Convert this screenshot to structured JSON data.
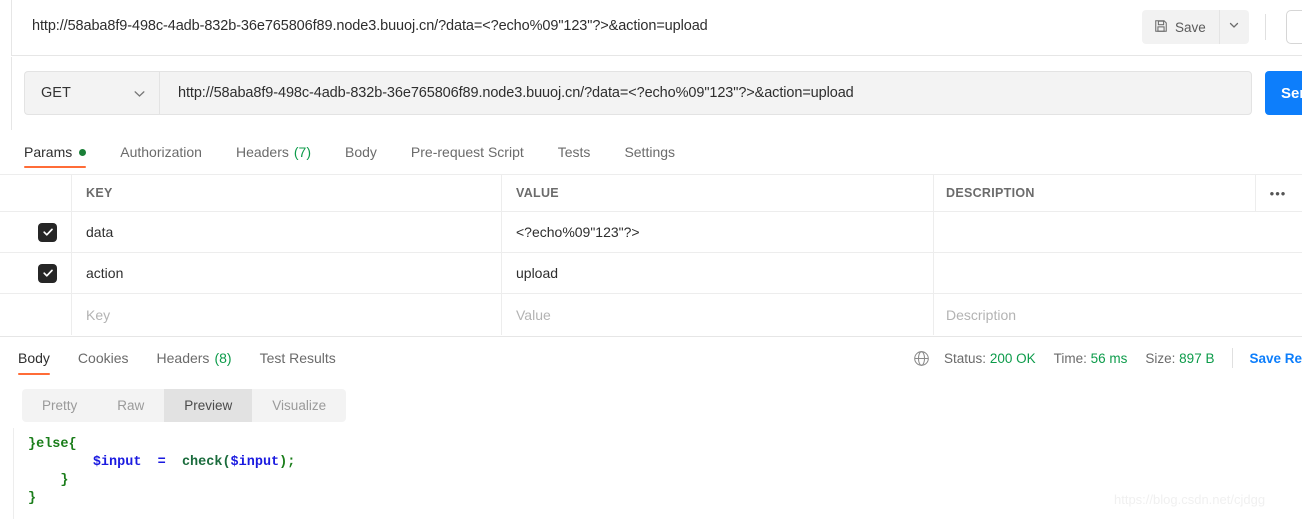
{
  "titlebar": {
    "request_title": "http://58aba8f9-498c-4adb-832b-36e765806f89.node3.buuoj.cn/?data=<?echo%09\"123\"?>&action=upload",
    "save_label": "Save"
  },
  "urlbar": {
    "method": "GET",
    "url": "http://58aba8f9-498c-4adb-832b-36e765806f89.node3.buuoj.cn/?data=<?echo%09\"123\"?>&action=upload",
    "send_label": "Send"
  },
  "request_tabs": [
    {
      "label": "Params",
      "active": true,
      "dot": true
    },
    {
      "label": "Authorization",
      "active": false
    },
    {
      "label": "Headers",
      "count": "(7)",
      "active": false
    },
    {
      "label": "Body",
      "active": false
    },
    {
      "label": "Pre-request Script",
      "active": false
    },
    {
      "label": "Tests",
      "active": false
    },
    {
      "label": "Settings",
      "active": false
    }
  ],
  "params_table": {
    "headers": {
      "key": "KEY",
      "value": "VALUE",
      "description": "DESCRIPTION",
      "more": "•••"
    },
    "rows": [
      {
        "checked": true,
        "key": "data",
        "value": "<?echo%09\"123\"?>",
        "description": ""
      },
      {
        "checked": true,
        "key": "action",
        "value": "upload",
        "description": ""
      }
    ],
    "placeholder_row": {
      "key": "Key",
      "value": "Value",
      "description": "Description"
    }
  },
  "response_tabs": [
    {
      "label": "Body",
      "active": true
    },
    {
      "label": "Cookies",
      "active": false
    },
    {
      "label": "Headers",
      "count": "(8)",
      "active": false
    },
    {
      "label": "Test Results",
      "active": false
    }
  ],
  "response_status": {
    "status_label": "Status:",
    "status_value": "200 OK",
    "time_label": "Time:",
    "time_value": "56 ms",
    "size_label": "Size:",
    "size_value": "897 B",
    "save_response_label": "Save Re"
  },
  "view_modes": [
    {
      "label": "Pretty",
      "active": false
    },
    {
      "label": "Raw",
      "active": false
    },
    {
      "label": "Preview",
      "active": true
    },
    {
      "label": "Visualize",
      "active": false
    }
  ],
  "response_body": {
    "line1": "}else{",
    "line2_var": "$input",
    "line2_eq": "=",
    "line2_fn": "check(",
    "line2_arg": "$input",
    "line2_end": ");",
    "line3": "}",
    "line4": "}"
  },
  "watermark": "https://blog.csdn.net/cjdgg",
  "colors": {
    "accent_orange": "#ff6c37",
    "send_blue": "#0d7efb",
    "status_green": "#0c9b4a",
    "code_green": "#1a7d1a",
    "code_blue": "#1a1ae0"
  }
}
